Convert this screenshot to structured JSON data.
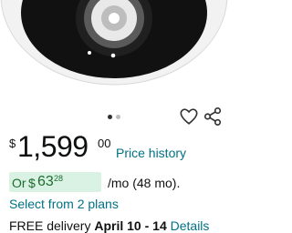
{
  "product": {
    "image_alt": "security-dome-camera"
  },
  "carousel": {
    "pages": 2,
    "active_page": 1
  },
  "actions": {
    "wishlist_icon": "heart-outline-icon",
    "share_icon": "share-icon"
  },
  "price": {
    "currency": "$",
    "whole": "1,599",
    "fraction": "00",
    "history_link": "Price history"
  },
  "financing": {
    "prefix": "Or",
    "currency": "$",
    "whole": "63",
    "fraction": "28",
    "term": "/mo (48 mo).",
    "highlight_color": "#d9f2e3"
  },
  "plans": {
    "link": "Select from 2 plans"
  },
  "delivery": {
    "label": "FREE delivery",
    "dates": "April 10 - 14",
    "details_link": "Details"
  },
  "colors": {
    "link": "#007185",
    "finance_green": "#1d6b2f"
  }
}
